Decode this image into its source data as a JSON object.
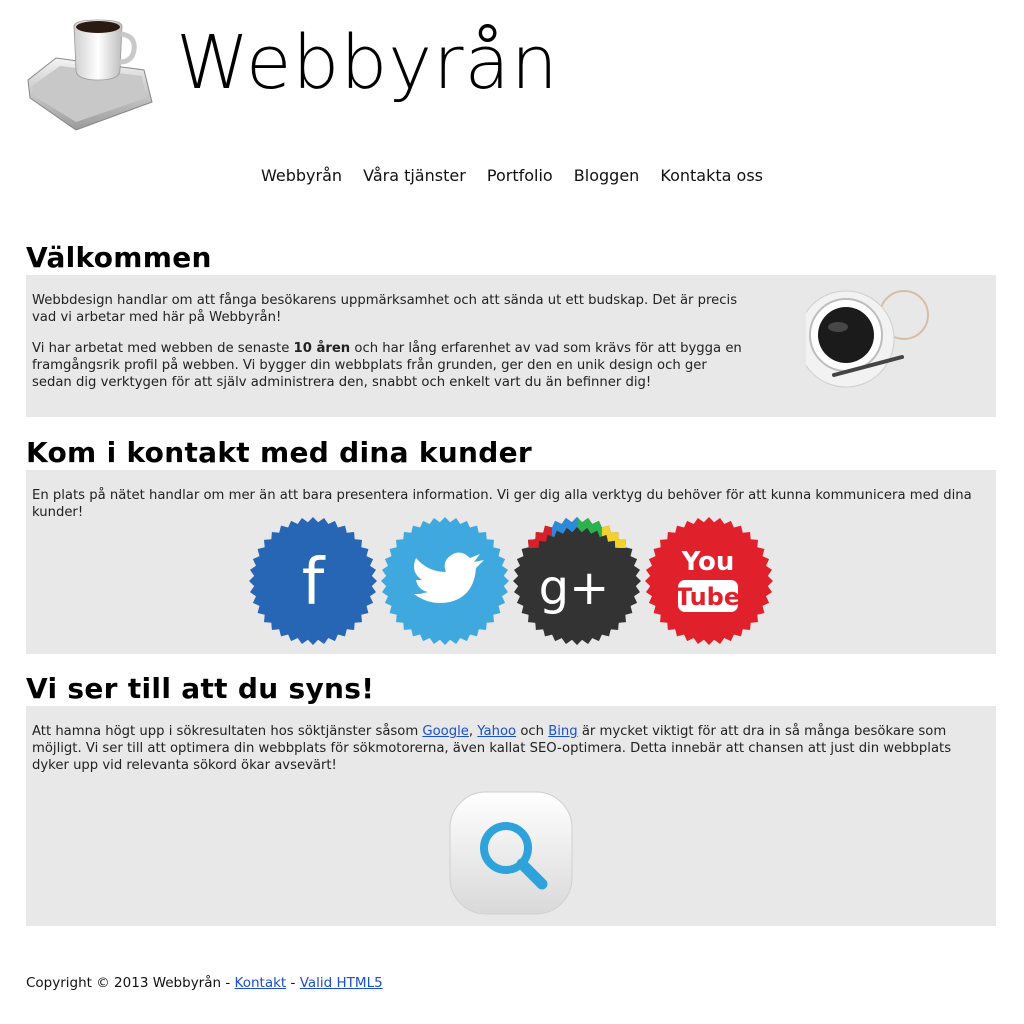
{
  "header": {
    "logo_text": "Webbyrån"
  },
  "nav": {
    "items": [
      "Webbyrån",
      "Våra tjänster",
      "Portfolio",
      "Bloggen",
      "Kontakta oss"
    ]
  },
  "section1": {
    "title": "Välkommen",
    "p1": "Webbdesign handlar om att fånga besökarens uppmärksamhet och att sända ut ett budskap. Det är precis vad vi arbetar med här på Webbyrån!",
    "p2_before": "Vi har arbetat med webben de senaste ",
    "p2_bold": "10 åren",
    "p2_after": " och har lång erfarenhet av vad som krävs för att bygga en framgångsrik profil på webben. Vi bygger din webbplats från grunden, ger den en unik design och ger sedan dig verktygen för att själv administrera den, snabbt och enkelt vart du än befinner dig!"
  },
  "section2": {
    "title": "Kom i kontakt med dina kunder",
    "text": "En plats på nätet handlar om mer än att bara presentera information. Vi ger dig alla verktyg du behöver för att kunna kommunicera med dina kunder!",
    "socials": [
      {
        "name": "facebook-icon",
        "label": "f",
        "color": "#2765b5"
      },
      {
        "name": "twitter-icon",
        "label": "",
        "color": "#3fa9df"
      },
      {
        "name": "googleplus-icon",
        "label": "g+",
        "color": "#333333"
      },
      {
        "name": "youtube-icon",
        "label_top": "You",
        "label_bottom": "Tube",
        "color": "#e0212b"
      }
    ]
  },
  "section3": {
    "title": "Vi ser till att du syns!",
    "text_before": "Att hamna högt upp i sökresultaten hos söktjänster såsom ",
    "link_google": "Google",
    "sep1": ", ",
    "link_yahoo": "Yahoo",
    "sep2": " och ",
    "link_bing": "Bing",
    "text_after": " är mycket viktigt för att dra in så många besökare som möjligt. Vi ser till att optimera din webbplats för sökmotorerna, även kallat SEO-optimera. Detta innebär att chansen att just din webbplats dyker upp vid relevanta sökord ökar avsevärt!"
  },
  "footer": {
    "copyright": "Copyright © 2013 Webbyrån",
    "sep1": " - ",
    "link_contact": "Kontakt",
    "sep2": " - ",
    "link_valid": "Valid HTML5"
  }
}
